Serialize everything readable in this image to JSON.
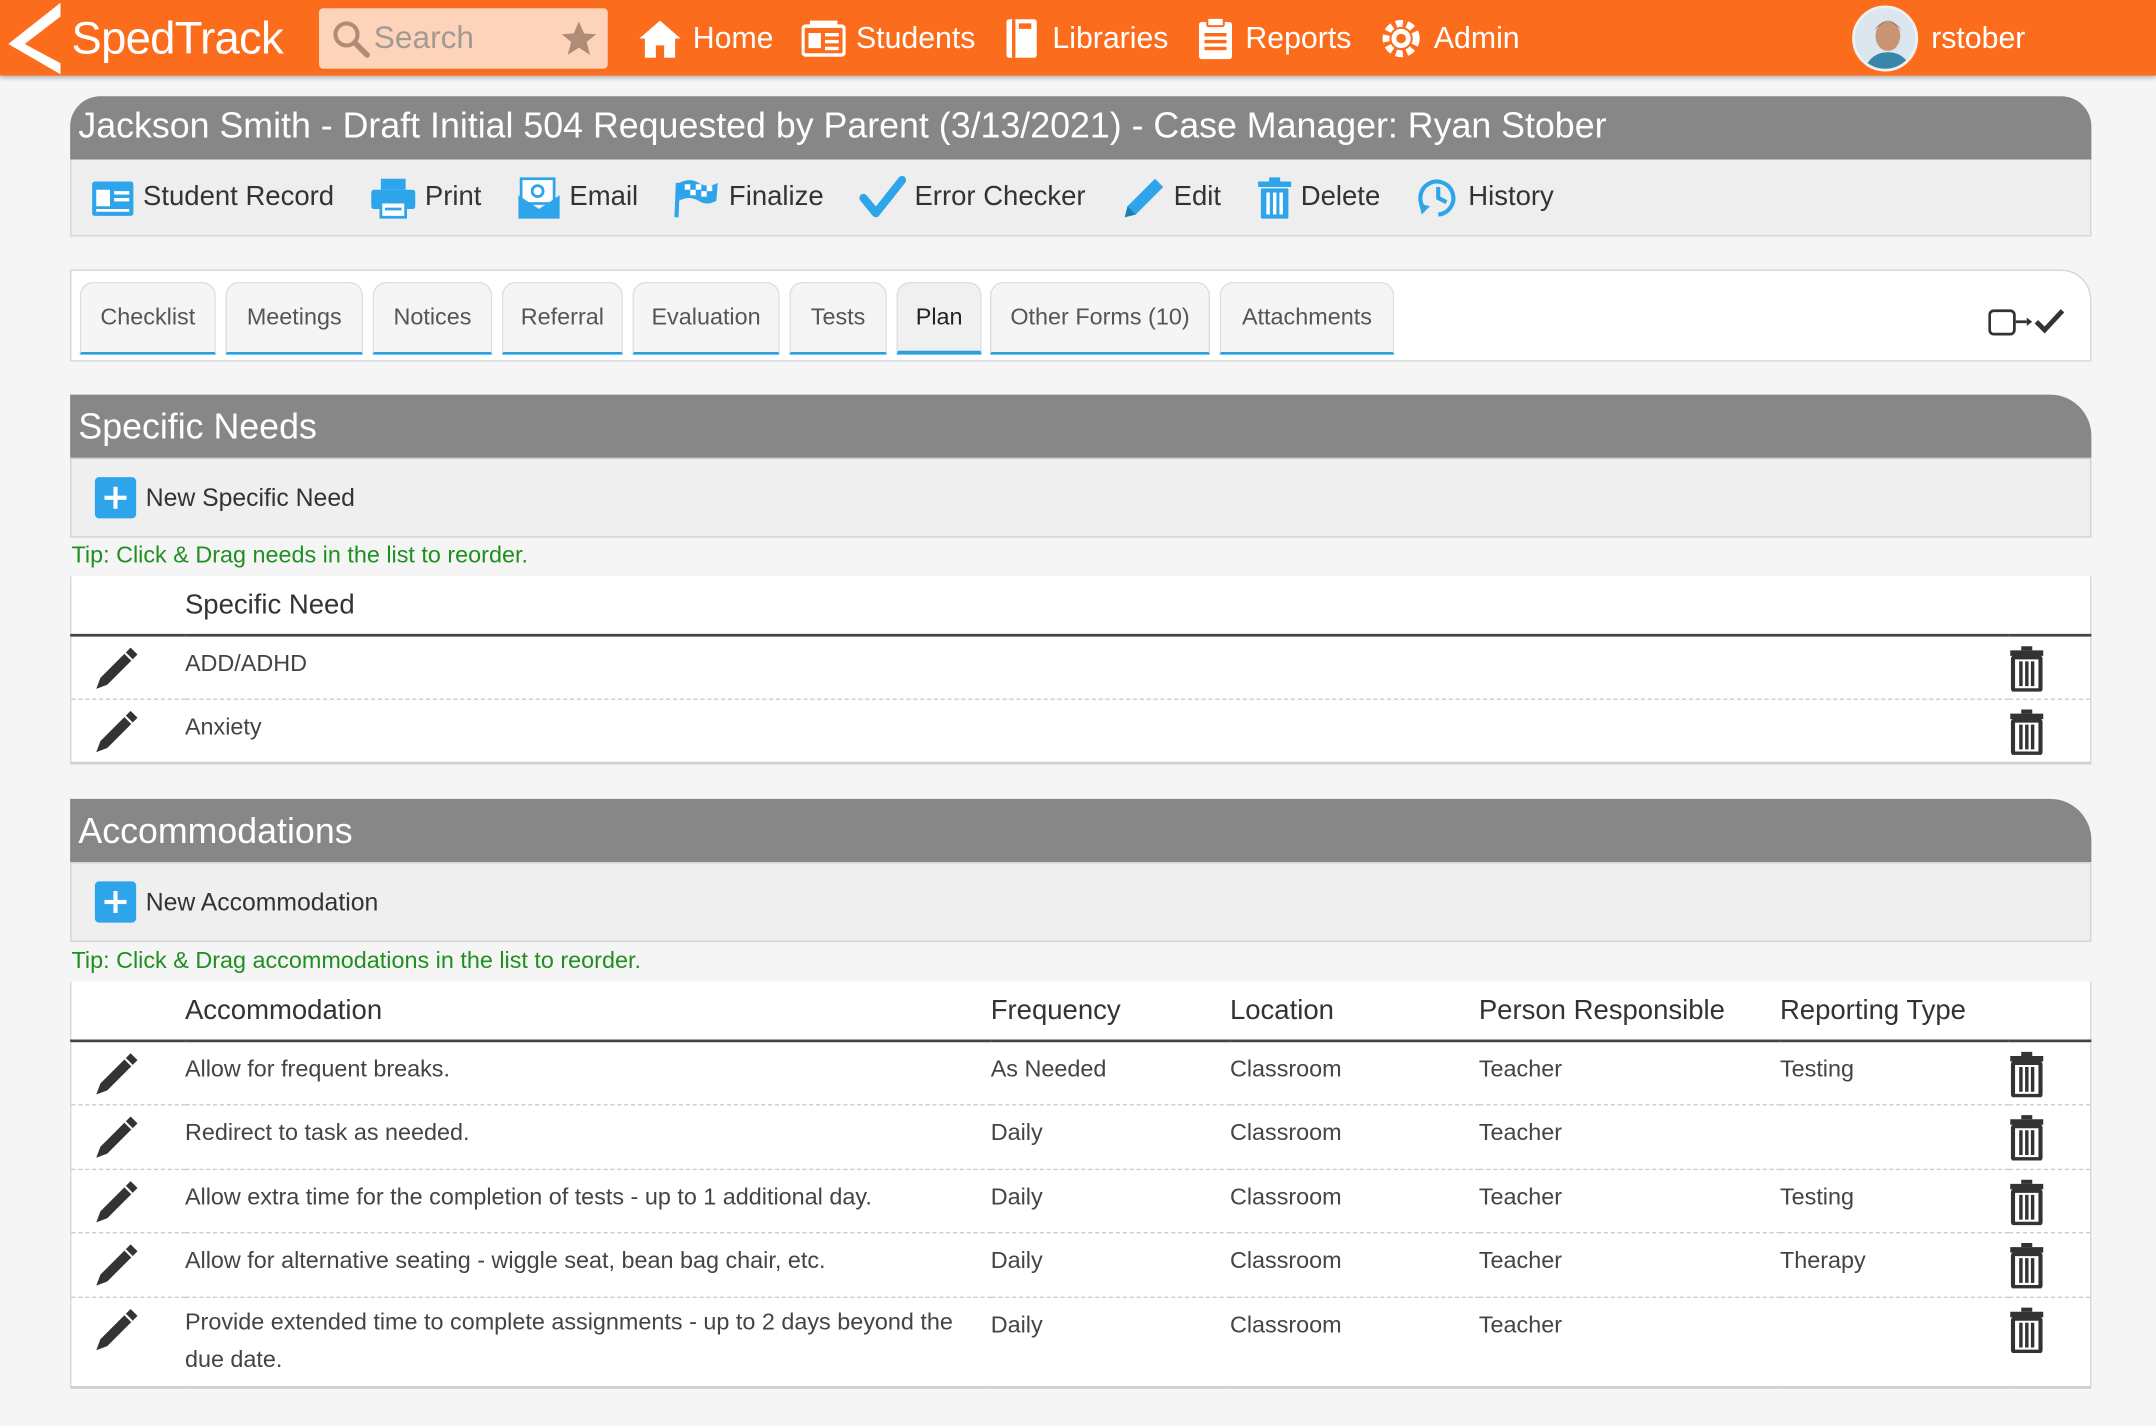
{
  "app": {
    "name": "SpedTrack",
    "brand_color": "#fb6d1d"
  },
  "search": {
    "placeholder": "Search"
  },
  "nav": {
    "items": [
      {
        "label": "Home",
        "icon": "home-icon"
      },
      {
        "label": "Students",
        "icon": "students-icon"
      },
      {
        "label": "Libraries",
        "icon": "libraries-icon"
      },
      {
        "label": "Reports",
        "icon": "reports-icon"
      },
      {
        "label": "Admin",
        "icon": "admin-icon"
      }
    ]
  },
  "user": {
    "name": "rstober"
  },
  "document": {
    "title": "Jackson Smith - Draft Initial 504 Requested by Parent (3/13/2021) - Case Manager: Ryan Stober"
  },
  "actions": [
    {
      "label": "Student Record",
      "icon": "student-record-icon"
    },
    {
      "label": "Print",
      "icon": "printer-icon"
    },
    {
      "label": "Email",
      "icon": "email-icon"
    },
    {
      "label": "Finalize",
      "icon": "checkered-flag-icon"
    },
    {
      "label": "Error Checker",
      "icon": "checkmark-icon"
    },
    {
      "label": "Edit",
      "icon": "pencil-icon"
    },
    {
      "label": "Delete",
      "icon": "trash-icon"
    },
    {
      "label": "History",
      "icon": "history-icon"
    }
  ],
  "tabs": [
    {
      "label": "Checklist"
    },
    {
      "label": "Meetings"
    },
    {
      "label": "Notices"
    },
    {
      "label": "Referral"
    },
    {
      "label": "Evaluation"
    },
    {
      "label": "Tests"
    },
    {
      "label": "Plan",
      "active": true
    },
    {
      "label": "Other Forms (10)"
    },
    {
      "label": "Attachments"
    }
  ],
  "specific_needs": {
    "header": "Specific Needs",
    "new_label": "New Specific Need",
    "tip": "Tip: Click & Drag needs in the list to reorder.",
    "column": "Specific Need",
    "rows": [
      "ADD/ADHD",
      "Anxiety"
    ]
  },
  "accommodations": {
    "header": "Accommodations",
    "new_label": "New Accommodation",
    "tip": "Tip: Click & Drag accommodations in the list to reorder.",
    "columns": [
      "Accommodation",
      "Frequency",
      "Location",
      "Person Responsible",
      "Reporting Type"
    ],
    "rows": [
      [
        "Allow for frequent breaks.",
        "As Needed",
        "Classroom",
        "Teacher",
        "Testing"
      ],
      [
        "Redirect to task as needed.",
        "Daily",
        "Classroom",
        "Teacher",
        ""
      ],
      [
        "Allow extra time for the completion of tests - up to 1 additional day.",
        "Daily",
        "Classroom",
        "Teacher",
        "Testing"
      ],
      [
        "Allow for alternative seating - wiggle seat, bean bag chair, etc.",
        "Daily",
        "Classroom",
        "Teacher",
        "Therapy"
      ],
      [
        "Provide extended time to complete assignments - up to 2 days beyond the due date.",
        "Daily",
        "Classroom",
        "Teacher",
        ""
      ]
    ]
  }
}
